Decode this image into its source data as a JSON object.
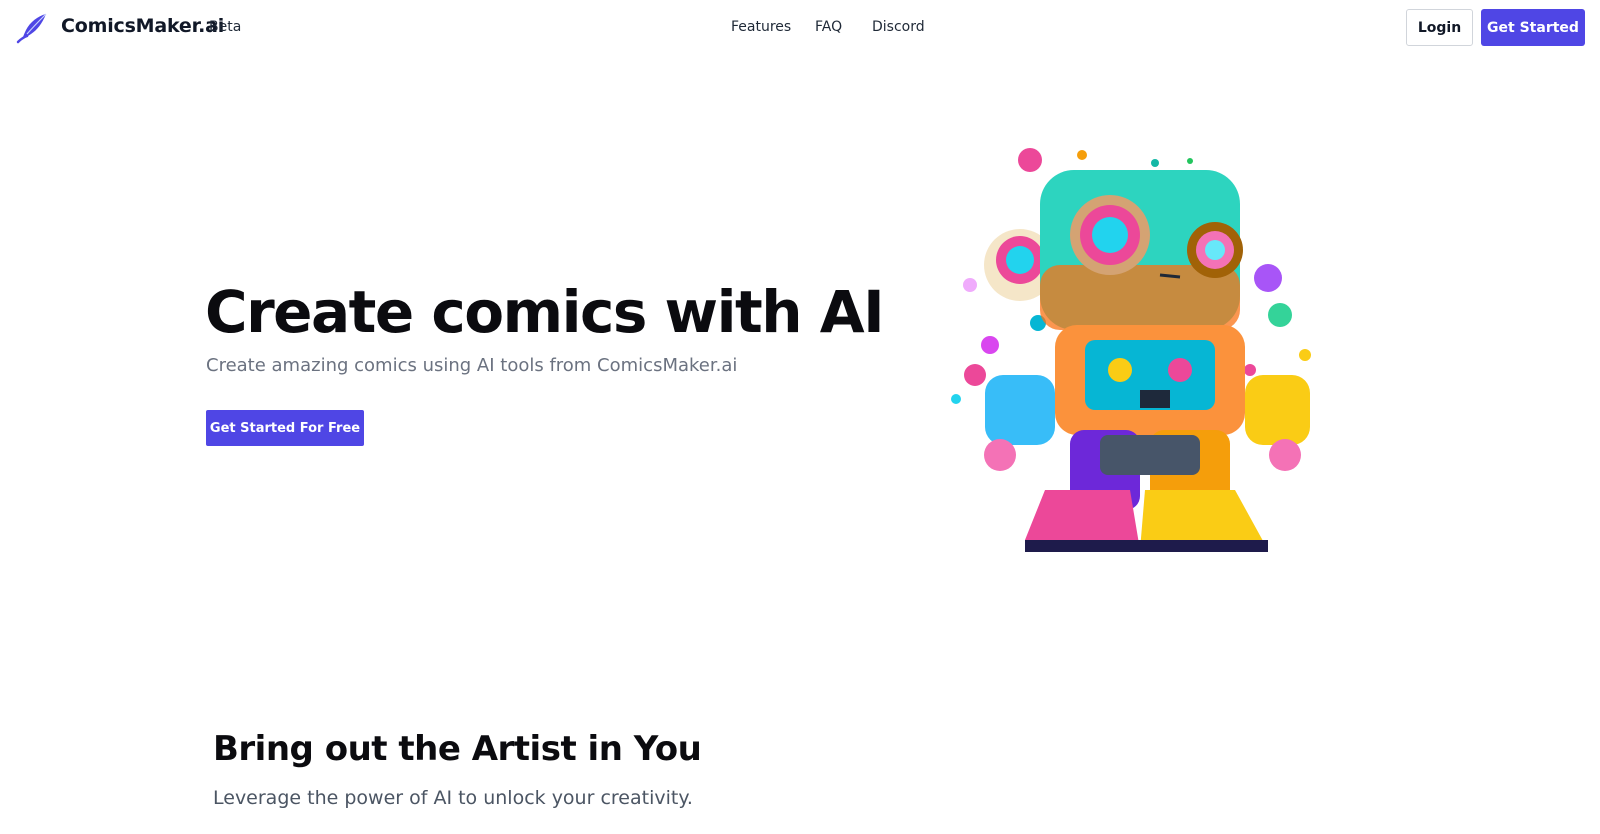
{
  "header": {
    "brand": "ComicsMaker.ai",
    "badge": "Beta",
    "logo_icon": "feather-brush-icon",
    "nav": {
      "features": "Features",
      "faq": "FAQ",
      "discord": "Discord"
    },
    "login_label": "Login",
    "get_started_label": "Get Started"
  },
  "hero": {
    "title": "Create comics with AI",
    "subtitle": "Create amazing comics using AI tools from ComicsMaker.ai",
    "cta_label": "Get Started For Free",
    "illustration": "colorful-robot-illustration"
  },
  "section": {
    "title": "Bring out the Artist in You",
    "subtitle": "Leverage the power of AI to unlock your creativity."
  },
  "colors": {
    "accent": "#4f46e5",
    "text_dark": "#0b0b0f",
    "text_muted": "#6b7280"
  }
}
